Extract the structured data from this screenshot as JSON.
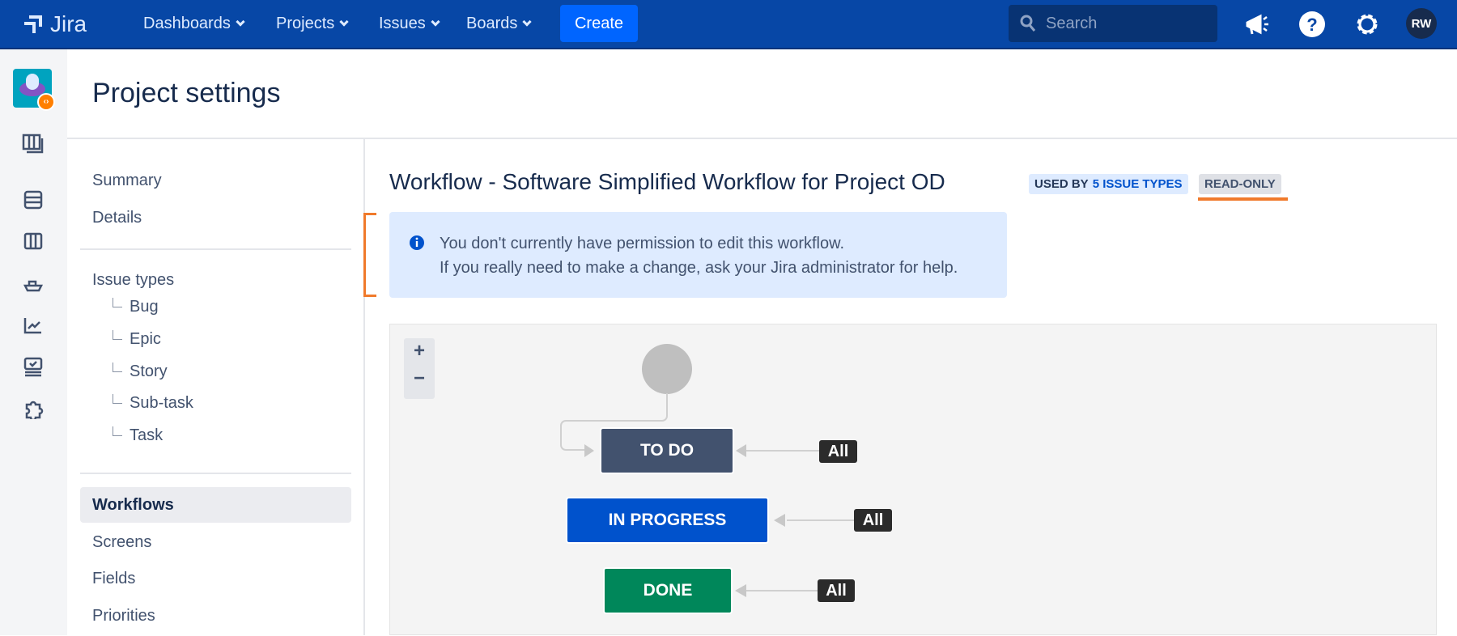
{
  "nav": {
    "logo": "Jira",
    "items": [
      {
        "label": "Dashboards"
      },
      {
        "label": "Projects"
      },
      {
        "label": "Issues"
      },
      {
        "label": "Boards"
      }
    ],
    "create": "Create",
    "search_placeholder": "Search",
    "avatar": "RW"
  },
  "page": {
    "title": "Project settings"
  },
  "sidebar": {
    "summary": "Summary",
    "details": "Details",
    "issue_types": "Issue types",
    "types": [
      "Bug",
      "Epic",
      "Story",
      "Sub-task",
      "Task"
    ],
    "workflows": "Workflows",
    "screens": "Screens",
    "fields": "Fields",
    "priorities": "Priorities"
  },
  "workflow": {
    "title": "Workflow - Software Simplified Workflow for Project OD",
    "used_by_prefix": "USED BY",
    "used_by_link": "5 ISSUE TYPES",
    "read_only": "READ-ONLY",
    "info_line1": "You don't currently have permission to edit this workflow.",
    "info_line2": "If you really need to make a change, ask your Jira administrator for help."
  },
  "diagram": {
    "zoom_in": "+",
    "zoom_out": "−",
    "statuses": [
      {
        "label": "TO DO",
        "color": "#42526e",
        "transition": "All"
      },
      {
        "label": "IN PROGRESS",
        "color": "#0052cc",
        "transition": "All"
      },
      {
        "label": "DONE",
        "color": "#00875a",
        "transition": "All"
      }
    ]
  },
  "colors": {
    "nav": "#0747a6",
    "accent": "#0065ff",
    "highlight": "#f07a2b"
  }
}
